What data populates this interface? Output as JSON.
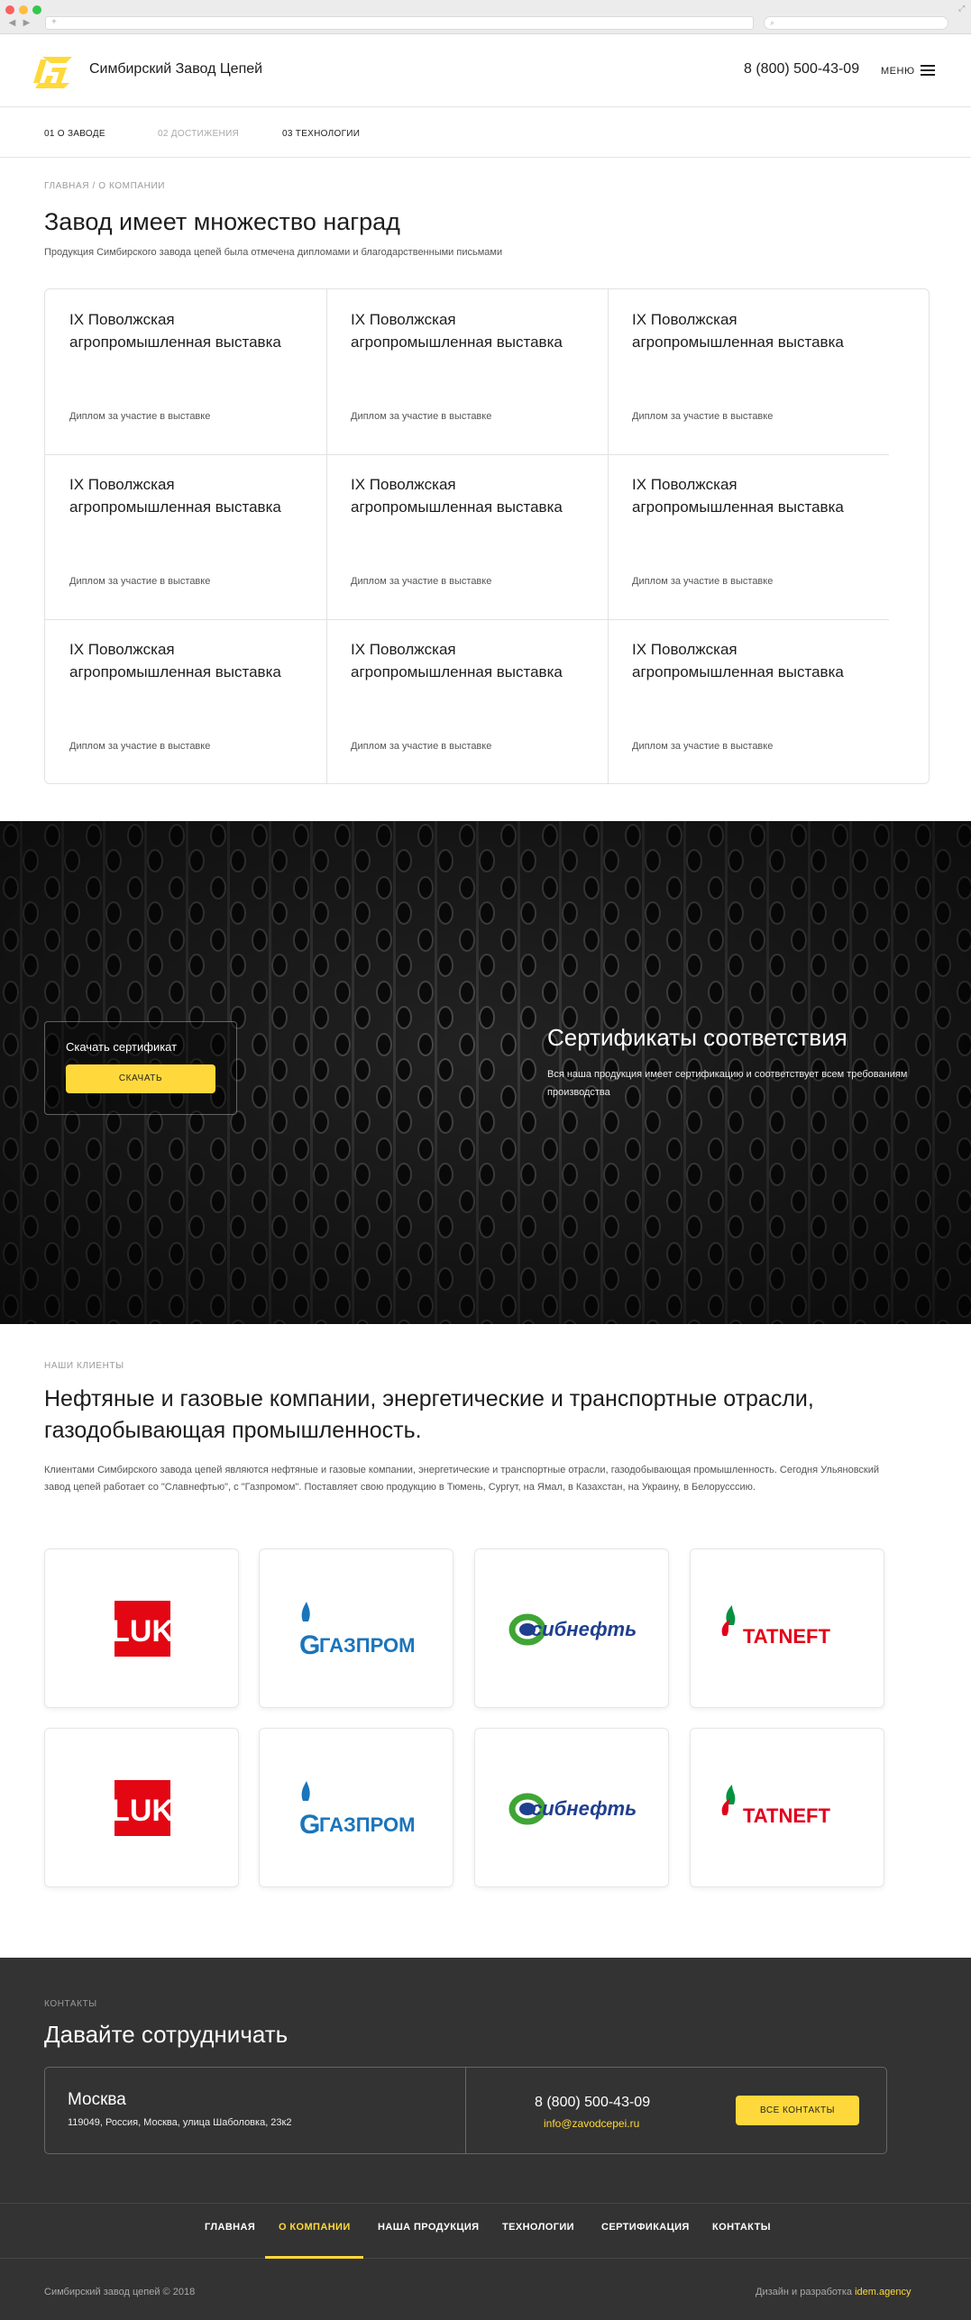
{
  "header": {
    "brand": "Симбирский Завод Цепей",
    "phone": "8 (800) 500-43-09",
    "menu_label": "МЕНЮ"
  },
  "tabs": [
    "01 О ЗАВОДЕ",
    "02 ДОСТИЖЕНИЯ",
    "03 ТЕХНОЛОГИИ"
  ],
  "breadcrumb": "ГЛАВНАЯ / О КОМПАНИИ",
  "awards_section": {
    "title": "Завод имеет множество наград",
    "subtitle": "Продукция Симбирского завода цепей была отмечена дипломами и благодарственными письмами",
    "items": [
      {
        "title": "IX Поволжская агропромышленная выставка",
        "desc": "Диплом за участие в выставке"
      },
      {
        "title": "IX Поволжская агропромышленная выставка",
        "desc": "Диплом за участие в выставке"
      },
      {
        "title": "IX Поволжская агропромышленная выставка",
        "desc": "Диплом за участие в выставке"
      },
      {
        "title": "IX Поволжская агропромышленная выставка",
        "desc": "Диплом за участие в выставке"
      },
      {
        "title": "IX Поволжская агропромышленная выставка",
        "desc": "Диплом за участие в выставке"
      },
      {
        "title": "IX Поволжская агропромышленная выставка",
        "desc": "Диплом за участие в выставке"
      },
      {
        "title": "IX Поволжская агропромышленная выставка",
        "desc": "Диплом за участие в выставке"
      },
      {
        "title": "IX Поволжская агропромышленная выставка",
        "desc": "Диплом за участие в выставке"
      },
      {
        "title": "IX Поволжская агропромышленная выставка",
        "desc": "Диплом за участие в выставке"
      }
    ]
  },
  "certificates": {
    "download_label": "Скачать сертификат",
    "download_button": "СКАЧАТЬ",
    "title": "Сертификаты соответствия",
    "text": "Вся наша продукция имеет сертификацию и соответствует всем требованиям производства"
  },
  "clients": {
    "label": "НАШИ КЛИЕНТЫ",
    "title": "Нефтяные и газовые компании, энергетические и транспортные отрасли, газодобывающая промышленность.",
    "text": "Клиентами Симбирского завода цепей являются нефтяные и газовые компании, энергетические и транспортные отрасли, газодобывающая промышленность. Сегодня Ульяновский завод цепей работает со \"Славнефтью\", с \"Газпромом\". Поставляет свою продукцию в Тюмень, Сургут, на Ямал, в Казахстан, на Украину, в Белорусссию.",
    "logos": [
      {
        "icon": "lukoil-logo-icon",
        "text": "LUK"
      },
      {
        "icon": "gazprom-logo-icon",
        "text": "ГАЗПРОМ"
      },
      {
        "icon": "sibneft-logo-icon",
        "text": "сибнефть"
      },
      {
        "icon": "tatneft-logo-icon",
        "text": "TATNEFT"
      },
      {
        "icon": "lukoil-logo-icon",
        "text": "LUK"
      },
      {
        "icon": "gazprom-logo-icon",
        "text": "ГАЗПРОМ"
      },
      {
        "icon": "sibneft-logo-icon",
        "text": "сибнефть"
      },
      {
        "icon": "tatneft-logo-icon",
        "text": "TATNEFT"
      }
    ]
  },
  "contacts": {
    "label": "КОНТАКТЫ",
    "title": "Давайте сотрудничать",
    "city": "Москва",
    "address": "119049, Россия, Москва, улица Шаболовка, 23к2",
    "phone": "8 (800) 500-43-09",
    "email": "info@zavodcepei.ru",
    "all_contacts_button": "ВСЕ КОНТАКТЫ"
  },
  "footer_nav": [
    "ГЛАВНАЯ",
    "О КОМПАНИИ",
    "НАША ПРОДУКЦИЯ",
    "ТЕХНОЛОГИИ",
    "СЕРТИФИКАЦИЯ",
    "КОНТАКТЫ"
  ],
  "footer_active_index": 1,
  "copyright": "Симбирский завод цепей © 2018",
  "credit_prefix": "Дизайн и разработка",
  "credit_link": "idem.agency",
  "colors": {
    "accent": "#ffd93b",
    "dark": "#333333",
    "lukoil_red": "#e30613",
    "gazprom_blue": "#1a75bb",
    "sibneft_blue": "#1f3f8f",
    "tatneft_red": "#e2001a",
    "tatneft_green": "#00923f"
  }
}
